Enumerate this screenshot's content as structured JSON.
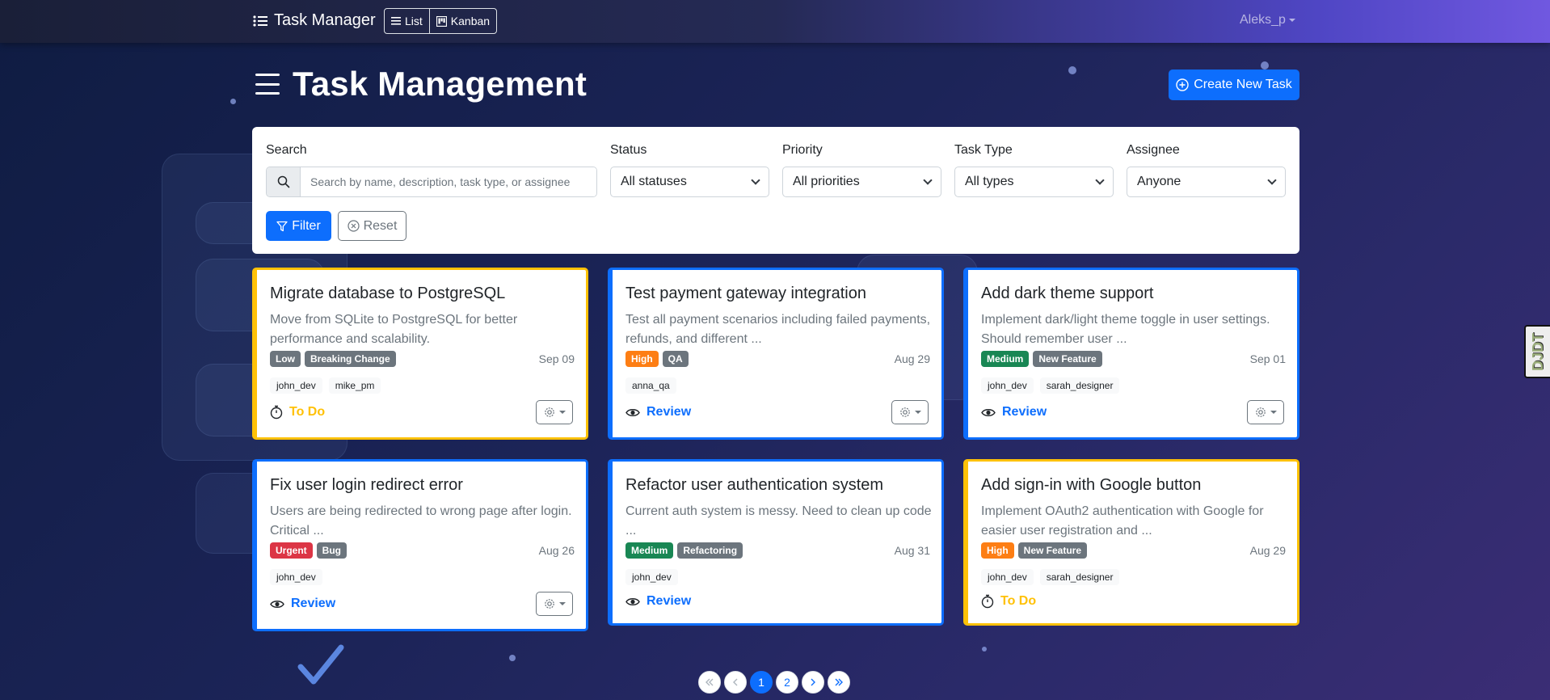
{
  "navbar": {
    "brand": "Task Manager",
    "views": [
      {
        "label": "List",
        "icon": "list-icon"
      },
      {
        "label": "Kanban",
        "icon": "kanban-icon"
      }
    ],
    "user": "Aleks_p"
  },
  "header": {
    "title": "Task Management",
    "create_label": "Create New Task"
  },
  "filters": {
    "search_label": "Search",
    "search_placeholder": "Search by name, description, task type, or assignee",
    "status_label": "Status",
    "status_value": "All statuses",
    "priority_label": "Priority",
    "priority_value": "All priorities",
    "type_label": "Task Type",
    "type_value": "All types",
    "assignee_label": "Assignee",
    "assignee_value": "Anyone",
    "filter_label": "Filter",
    "reset_label": "Reset"
  },
  "cards": [
    {
      "title": "Migrate database to PostgreSQL",
      "description": "Move from SQLite to PostgreSQL for better performance and scalability.",
      "badges": [
        {
          "text": "Low",
          "color": "#6c757d"
        },
        {
          "text": "Breaking Change",
          "color": "#6c757d"
        }
      ],
      "date": "Sep 09",
      "assignees": [
        "john_dev",
        "mike_pm"
      ],
      "status": "To Do",
      "status_kind": "todo",
      "has_actions": true
    },
    {
      "title": "Test payment gateway integration",
      "description": "Test all payment scenarios including failed payments, refunds, and different ...",
      "badges": [
        {
          "text": "High",
          "color": "#fd7e14"
        },
        {
          "text": "QA",
          "color": "#6c757d"
        }
      ],
      "date": "Aug 29",
      "assignees": [
        "anna_qa"
      ],
      "status": "Review",
      "status_kind": "review",
      "has_actions": true
    },
    {
      "title": "Add dark theme support",
      "description": "Implement dark/light theme toggle in user settings. Should remember user ...",
      "badges": [
        {
          "text": "Medium",
          "color": "#198754"
        },
        {
          "text": "New Feature",
          "color": "#6c757d"
        }
      ],
      "date": "Sep 01",
      "assignees": [
        "john_dev",
        "sarah_designer"
      ],
      "status": "Review",
      "status_kind": "review",
      "has_actions": true
    },
    {
      "title": "Fix user login redirect error",
      "description": "Users are being redirected to wrong page after login. Critical ...",
      "badges": [
        {
          "text": "Urgent",
          "color": "#dc3545"
        },
        {
          "text": "Bug",
          "color": "#6c757d"
        }
      ],
      "date": "Aug 26",
      "assignees": [
        "john_dev"
      ],
      "status": "Review",
      "status_kind": "review",
      "has_actions": true
    },
    {
      "title": "Refactor user authentication system",
      "description": "Current auth system is messy. Need to clean up code ...",
      "badges": [
        {
          "text": "Medium",
          "color": "#198754"
        },
        {
          "text": "Refactoring",
          "color": "#6c757d"
        }
      ],
      "date": "Aug 31",
      "assignees": [
        "john_dev"
      ],
      "status": "Review",
      "status_kind": "review",
      "has_actions": false
    },
    {
      "title": "Add sign-in with Google button",
      "description": "Implement OAuth2 authentication with Google for easier user registration and ...",
      "badges": [
        {
          "text": "High",
          "color": "#fd7e14"
        },
        {
          "text": "New Feature",
          "color": "#6c757d"
        }
      ],
      "date": "Aug 29",
      "assignees": [
        "john_dev",
        "sarah_designer"
      ],
      "status": "To Do",
      "status_kind": "todo",
      "has_actions": false
    }
  ],
  "pagination": {
    "pages": [
      "1",
      "2"
    ],
    "current": "1"
  },
  "debug_toolbar": "DJDT",
  "colors": {
    "primary": "#0d6efd",
    "todo": "#ffc107",
    "review": "#0d6efd"
  }
}
